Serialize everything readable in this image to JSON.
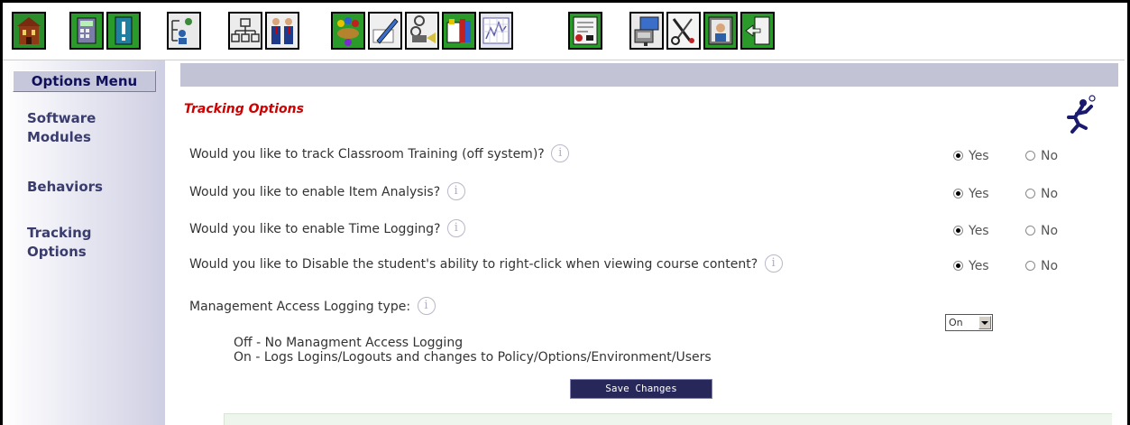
{
  "toolbar": {
    "icons": [
      {
        "name": "home-building-icon"
      },
      {
        "name": "calculator-icon"
      },
      {
        "name": "alert-icon"
      },
      {
        "name": "user-tree-icon"
      },
      {
        "name": "org-chart-icon"
      },
      {
        "name": "people-icon"
      },
      {
        "name": "meeting-icon"
      },
      {
        "name": "pencil-icon"
      },
      {
        "name": "film-camera-icon"
      },
      {
        "name": "library-icon"
      },
      {
        "name": "report-chart-icon"
      },
      {
        "name": "certificate-icon"
      },
      {
        "name": "computer-icon"
      },
      {
        "name": "tools-icon"
      },
      {
        "name": "profile-icon"
      },
      {
        "name": "exit-door-icon"
      }
    ]
  },
  "sidebar": {
    "header": "Options Menu",
    "items": [
      {
        "line1": "Software",
        "line2": "Modules"
      },
      {
        "line1": "Behaviors",
        "line2": ""
      },
      {
        "line1": "Tracking",
        "line2": "Options"
      }
    ]
  },
  "main": {
    "title": "Tracking Options",
    "questions": [
      {
        "text": "Would you like to track Classroom Training (off system)?",
        "yes": "Yes",
        "no": "No",
        "selected": "yes"
      },
      {
        "text": "Would you like to enable Item Analysis?",
        "yes": "Yes",
        "no": "No",
        "selected": "yes"
      },
      {
        "text": "Would you like to enable Time Logging?",
        "yes": "Yes",
        "no": "No",
        "selected": "yes"
      },
      {
        "text": "Would you like to Disable the student's ability to right-click when viewing course content?",
        "yes": "Yes",
        "no": "No",
        "selected": "yes"
      }
    ],
    "logging": {
      "label": "Management Access Logging type:",
      "off_desc": "Off - No Managment Access Logging",
      "on_desc": "On - Logs Logins/Logouts and changes to Policy/Options/Environment/Users",
      "selected": "On"
    },
    "save_label": "Save Changes"
  },
  "colors": {
    "accent_title": "#d00000",
    "sidebar_text": "#3a3c6e",
    "save_button": "#27275a",
    "toolbar_icon_bg": "#2a9a2a"
  }
}
